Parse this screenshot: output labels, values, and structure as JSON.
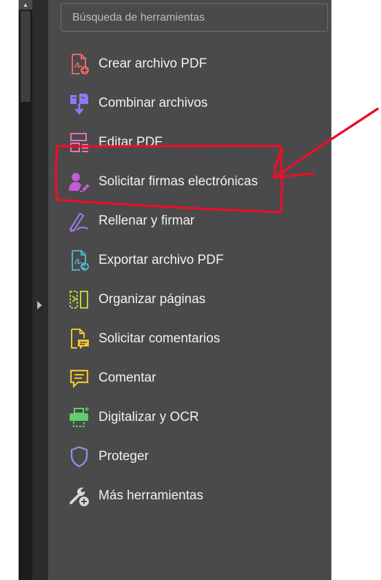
{
  "search": {
    "placeholder": "Búsqueda de herramientas"
  },
  "tools": [
    {
      "label": "Crear archivo PDF",
      "icon": "create-pdf-icon"
    },
    {
      "label": "Combinar archivos",
      "icon": "combine-files-icon"
    },
    {
      "label": "Editar PDF",
      "icon": "edit-pdf-icon"
    },
    {
      "label": "Solicitar firmas electrónicas",
      "icon": "request-esign-icon"
    },
    {
      "label": "Rellenar y firmar",
      "icon": "fill-sign-icon"
    },
    {
      "label": "Exportar archivo PDF",
      "icon": "export-pdf-icon"
    },
    {
      "label": "Organizar páginas",
      "icon": "organize-pages-icon"
    },
    {
      "label": "Solicitar comentarios",
      "icon": "request-comments-icon"
    },
    {
      "label": "Comentar",
      "icon": "comment-icon"
    },
    {
      "label": "Digitalizar y OCR",
      "icon": "scan-ocr-icon"
    },
    {
      "label": "Proteger",
      "icon": "protect-icon"
    },
    {
      "label": "Más herramientas",
      "icon": "more-tools-icon"
    }
  ],
  "colors": {
    "panel_bg": "#4a4a4a",
    "annotation_red": "#e8102a"
  }
}
